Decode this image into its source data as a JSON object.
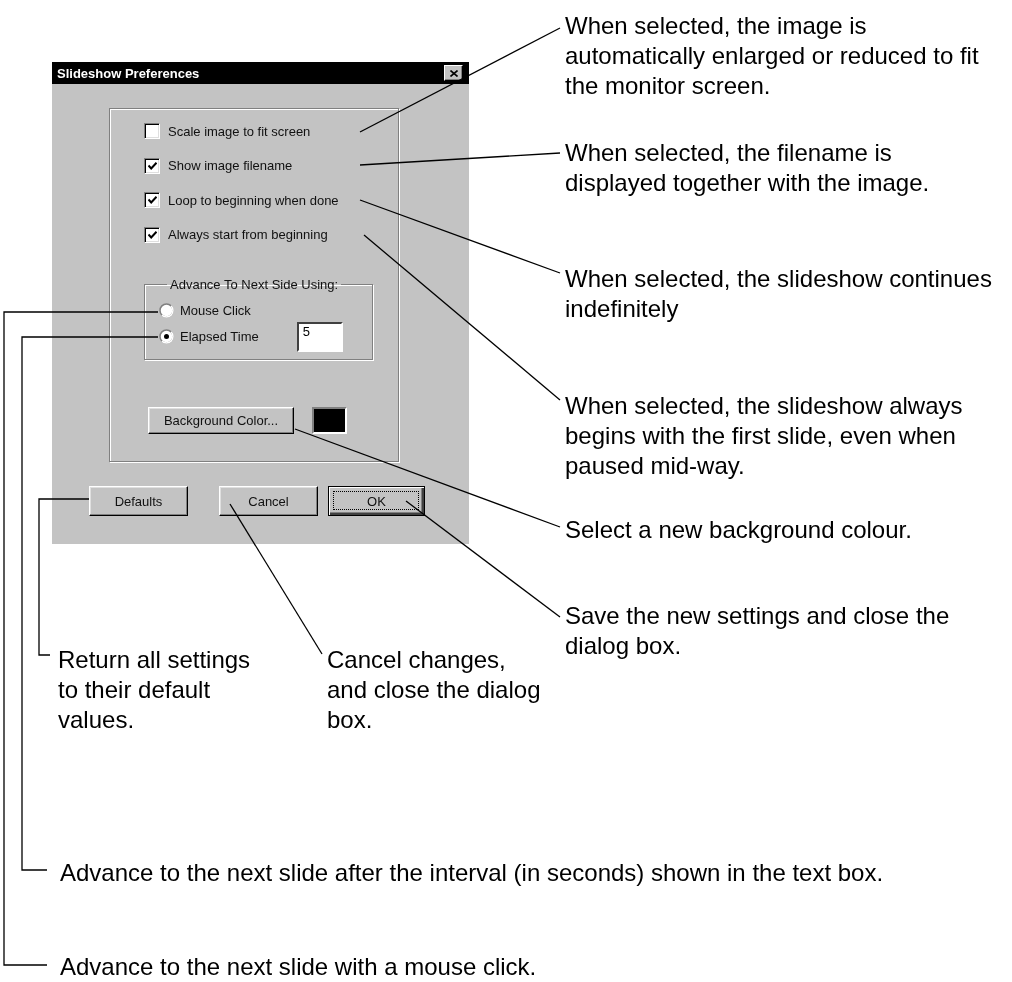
{
  "dialog": {
    "title": "Slideshow Preferences",
    "options": [
      {
        "label": "Scale image to fit screen",
        "checked": false
      },
      {
        "label": "Show image filename",
        "checked": true
      },
      {
        "label": "Loop to beginning when done",
        "checked": true
      },
      {
        "label": "Always start from beginning",
        "checked": true
      }
    ],
    "advance": {
      "legend": "Advance To Next Side Using:",
      "choices": [
        {
          "label": "Mouse Click",
          "selected": false
        },
        {
          "label": "Elapsed Time",
          "selected": true,
          "seconds": "5"
        }
      ]
    },
    "background": {
      "button": "Background Color...",
      "color": "#000000"
    },
    "buttons": [
      {
        "label": "Defaults",
        "default": false
      },
      {
        "label": "Cancel",
        "default": false
      },
      {
        "label": "OK",
        "default": true
      }
    ]
  },
  "callouts": [
    {
      "lines": [
        "When selected, the image is",
        "automatically enlarged or reduced to fit",
        "the monitor screen."
      ]
    },
    {
      "lines": [
        "When selected, the filename is",
        "displayed together with the image."
      ]
    },
    {
      "lines": [
        "When selected, the slideshow continues",
        "indefinitely"
      ]
    },
    {
      "lines": [
        "When selected, the slideshow always",
        "begins with the first slide, even when",
        "paused mid-way."
      ]
    },
    {
      "lines": [
        "Select a new background colour."
      ]
    },
    {
      "lines": [
        "Save the new settings and close the",
        "dialog box."
      ]
    },
    {
      "lines": [
        "Return all settings",
        "to their default",
        "values."
      ]
    },
    {
      "lines": [
        "Cancel changes,",
        "and close the dialog",
        "box."
      ]
    },
    {
      "lines": [
        "Advance to the next slide after the interval (in seconds) shown in the text box."
      ]
    },
    {
      "lines": [
        "Advance to the next slide with a mouse click."
      ]
    }
  ]
}
